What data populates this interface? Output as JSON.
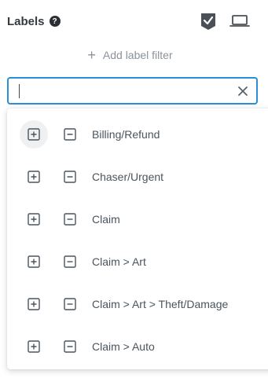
{
  "header": {
    "title": "Labels",
    "help_icon": "question-circle-icon",
    "icons": [
      "badge-check-icon",
      "laptop-icon"
    ]
  },
  "add_filter": {
    "icon": "plus-icon",
    "label": "Add label filter"
  },
  "search": {
    "value": "",
    "placeholder": "",
    "clear_icon": "close-icon",
    "focus_color": "#2b8ed7"
  },
  "dropdown": {
    "options": [
      {
        "label": "Billing/Refund"
      },
      {
        "label": "Chaser/Urgent"
      },
      {
        "label": "Claim"
      },
      {
        "label": "Claim > Art"
      },
      {
        "label": "Claim > Art > Theft/Damage"
      },
      {
        "label": "Claim > Auto"
      }
    ],
    "include_icon": "plus-square-icon",
    "exclude_icon": "minus-square-icon"
  }
}
